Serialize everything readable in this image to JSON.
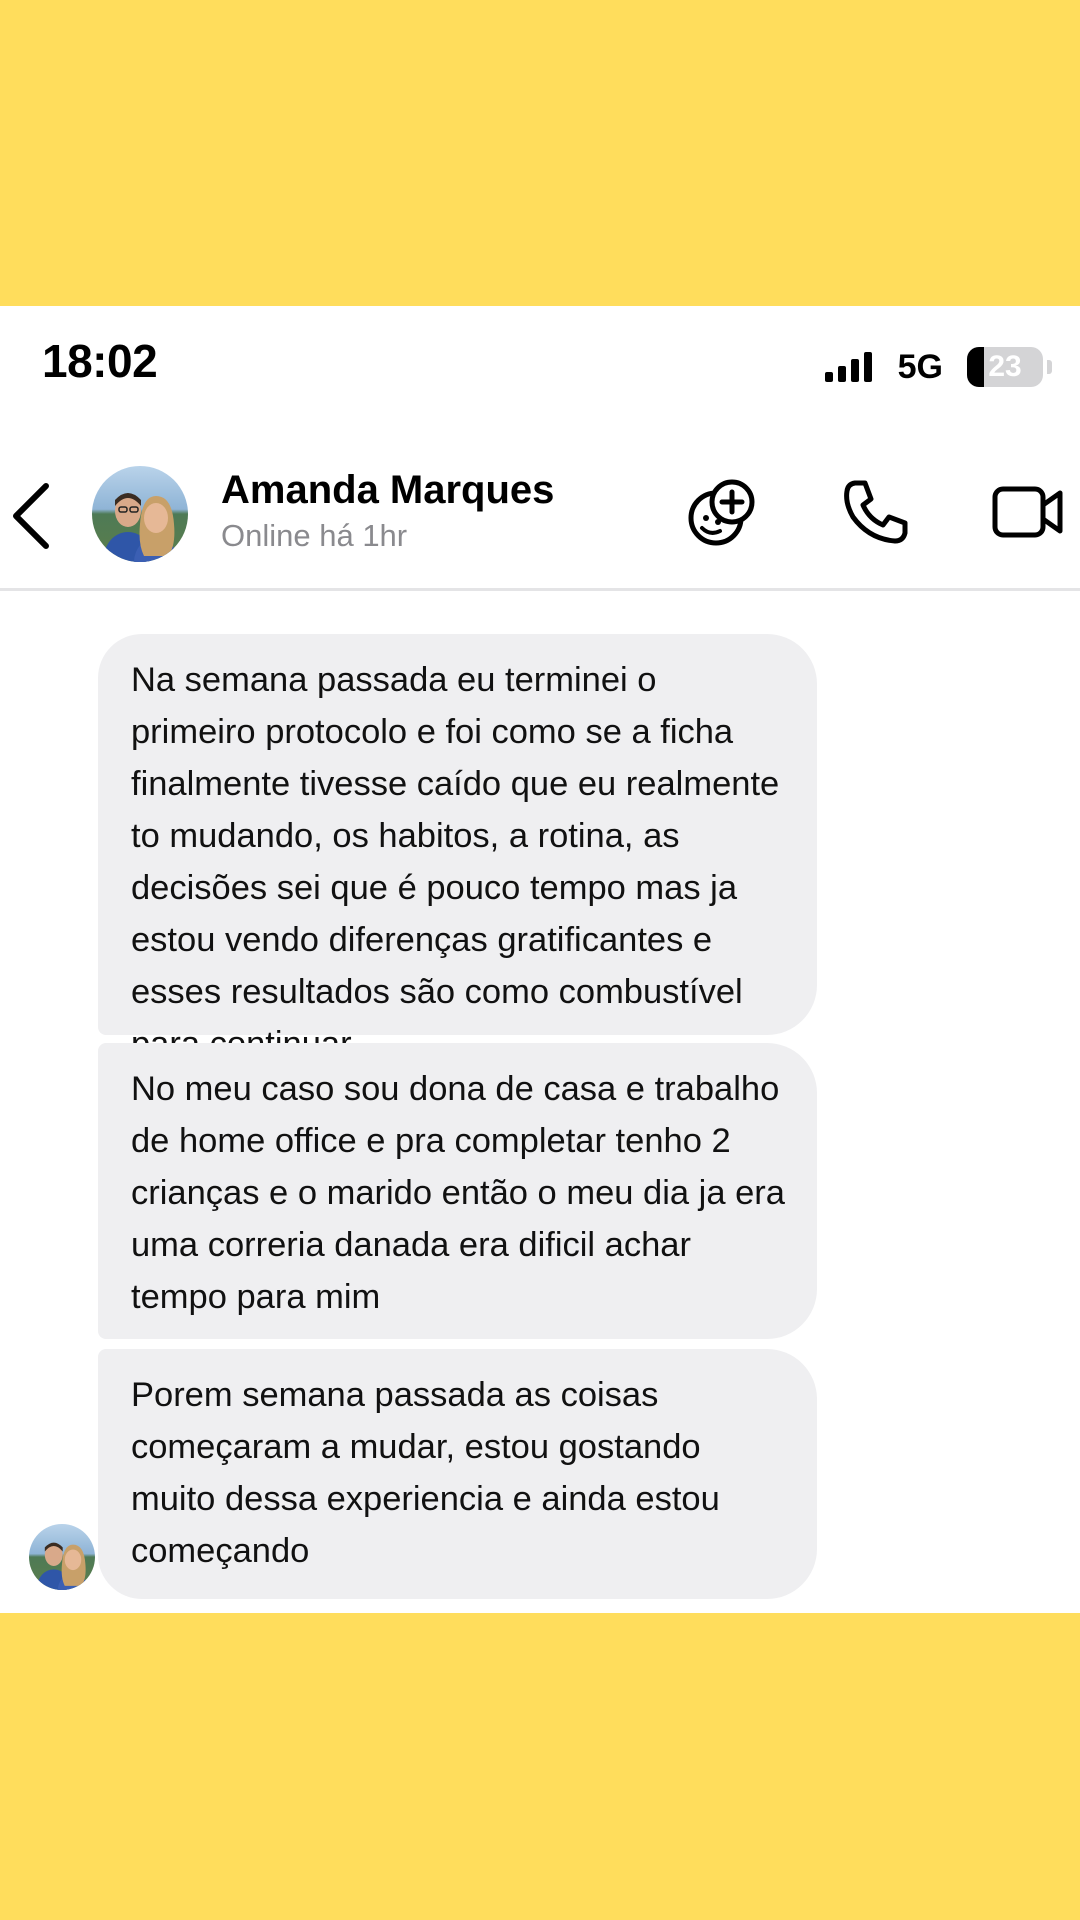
{
  "status_bar": {
    "time": "18:02",
    "network": "5G",
    "battery_level": "23",
    "battery_fraction": 0.23
  },
  "header": {
    "contact_name": "Amanda Marques",
    "contact_status": "Online há 1hr",
    "icons": [
      "back-chevron-icon",
      "avatar",
      "sticker-add-icon",
      "phone-icon",
      "video-camera-icon"
    ]
  },
  "messages": [
    {
      "sender": "Amanda Marques",
      "text": "Na semana passada eu terminei o primeiro protocolo e foi como se a ficha finalmente tivesse caído que eu realmente to mudando, os habitos, a rotina, as decisões sei que é pouco tempo mas ja estou vendo diferenças gratificantes e esses resultados são como combustível para continuar"
    },
    {
      "sender": "Amanda Marques",
      "text": "No meu caso sou dona de casa e trabalho de home office e pra completar tenho 2 crianças e o marido então o meu dia ja era uma correria danada era dificil achar tempo para mim"
    },
    {
      "sender": "Amanda Marques",
      "text": "Porem semana passada as coisas começaram a mudar, estou gostando muito dessa experiencia e ainda estou começando"
    }
  ],
  "colors": {
    "background": "#FFDD5C",
    "bubble": "#EFEFF1",
    "status_text": "#8A8A8E"
  }
}
